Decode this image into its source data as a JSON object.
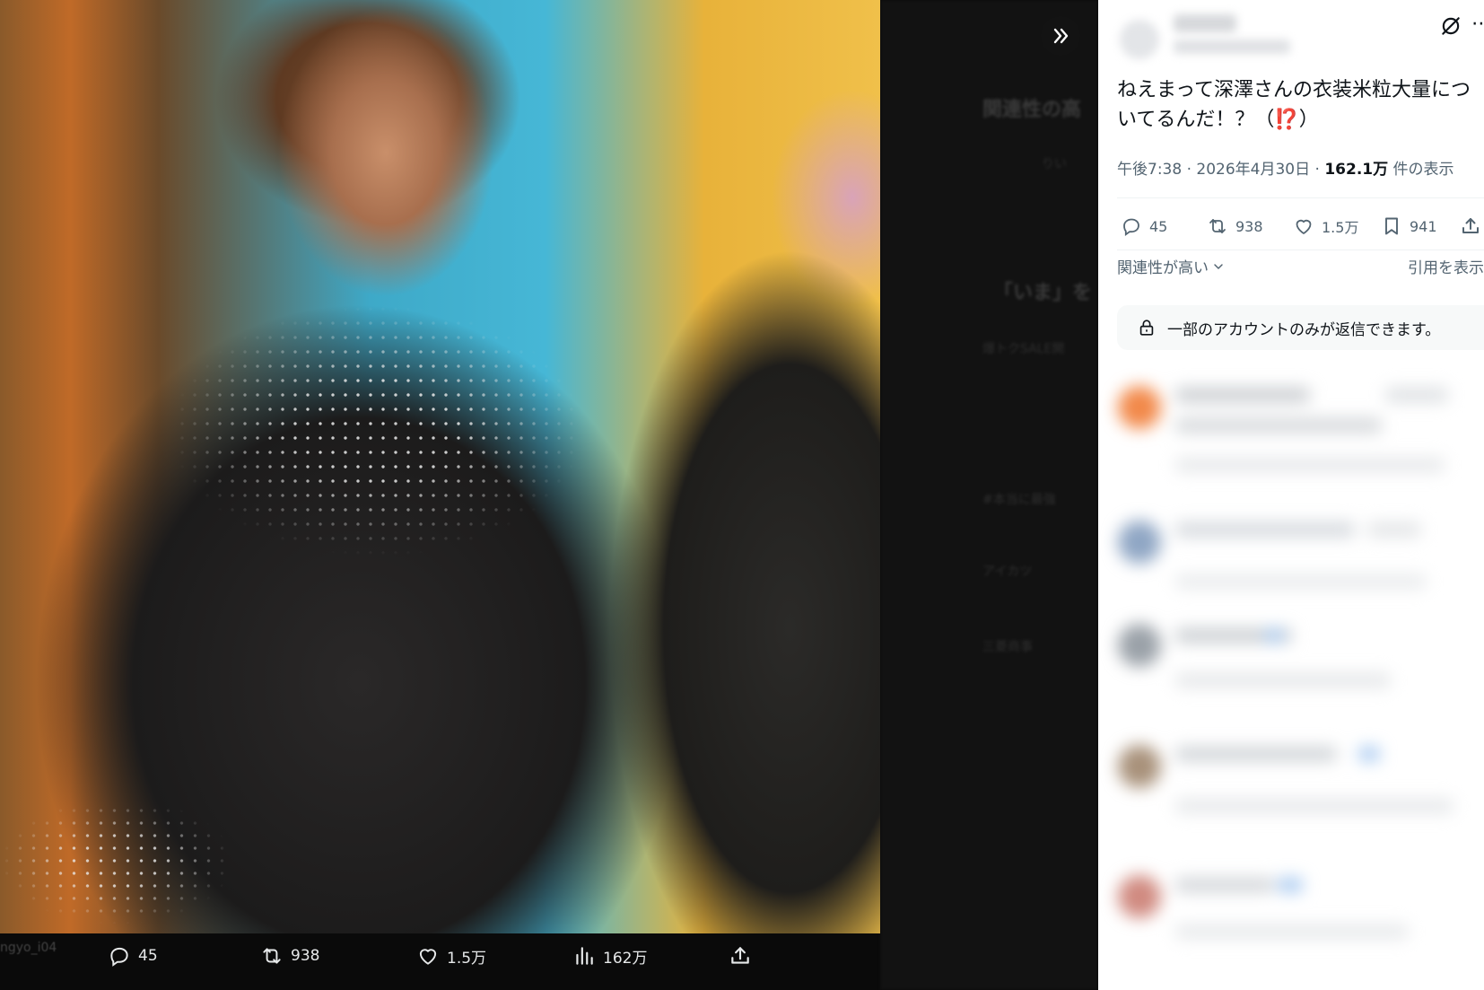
{
  "post": {
    "text": "ねえまって深澤さんの衣装米粒大量についてるんだ！？（⁉️）",
    "time": "午後7:38",
    "date": "2026年4月30日",
    "views_value": "162.1万",
    "views_label": "件の表示",
    "separator": "·"
  },
  "stats": {
    "replies": "45",
    "reposts": "938",
    "likes": "1.5万",
    "bookmarks": "941"
  },
  "replies_header": {
    "sort_label": "関連性が高い",
    "quotes_label": "引用を表示"
  },
  "reply_restriction": {
    "text": "一部のアカウントのみが返信できます。"
  },
  "media_actions": {
    "replies": "45",
    "reposts": "938",
    "likes": "1.5万",
    "views": "162万"
  },
  "background_feed": {
    "heading_1": "関連性の高",
    "user_short": "りい",
    "heading_2": "「いま」を",
    "promo": "爆トクSALE開",
    "trend_1": "#本当に最強",
    "trend_2": "アイカツ",
    "trend_3": "三菱商事",
    "handle": "ngyo_i04"
  },
  "icons": {
    "expand": "double-chevron-right-icon",
    "grok": "grok-icon",
    "more": "more-icon",
    "reply": "reply-icon",
    "repost": "repost-icon",
    "like": "heart-icon",
    "bookmark": "bookmark-icon",
    "share": "share-icon",
    "views": "views-chart-icon",
    "lock": "lock-icon",
    "chevron": "chevron-down-icon"
  },
  "colors": {
    "panel_bg": "#ffffff",
    "text_primary": "#0f1419",
    "text_secondary": "#536471",
    "media_bg": "#000000",
    "media_text": "#e7e9ea"
  }
}
